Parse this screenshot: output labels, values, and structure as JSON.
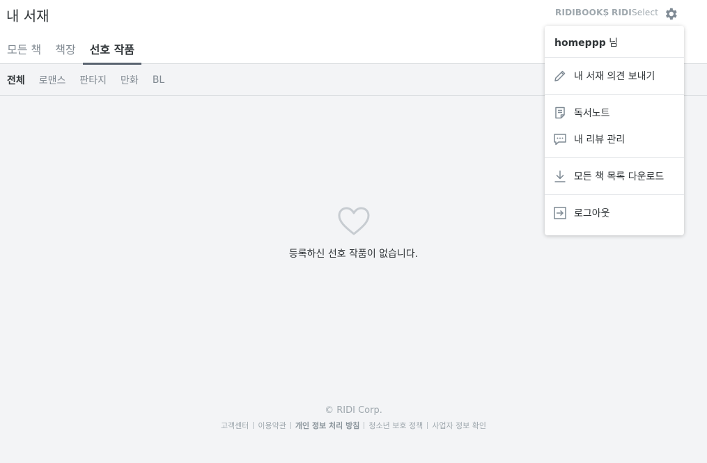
{
  "header": {
    "title": "내 서재",
    "brand_ridibooks": "RIDIBOOKS",
    "brand_ridi": "RIDI",
    "brand_select": "Select",
    "settings_icon": "gear-icon"
  },
  "main_tabs": [
    {
      "label": "모든 책",
      "active": false
    },
    {
      "label": "책장",
      "active": false
    },
    {
      "label": "선호 작품",
      "active": true
    }
  ],
  "sub_tabs": [
    {
      "label": "전체",
      "active": true
    },
    {
      "label": "로맨스",
      "active": false
    },
    {
      "label": "판타지",
      "active": false
    },
    {
      "label": "만화",
      "active": false
    },
    {
      "label": "BL",
      "active": false
    }
  ],
  "empty_state": {
    "icon": "heart-outline-icon",
    "message": "등록하신 선호 작품이 없습니다."
  },
  "menu": {
    "username": "homeppp",
    "honorific": " 님",
    "items": [
      {
        "label": "내 서재 의견 보내기",
        "icon": "pencil-icon"
      },
      {
        "label": "독서노트",
        "icon": "note-icon"
      },
      {
        "label": "내 리뷰 관리",
        "icon": "comment-icon"
      },
      {
        "label": "모든 책 목록 다운로드",
        "icon": "download-icon"
      },
      {
        "label": "로그아웃",
        "icon": "logout-icon"
      }
    ]
  },
  "footer": {
    "copyright": "© RIDI Corp.",
    "links": [
      "고객센터",
      "이용약관",
      "개인 정보 처리 방침",
      "청소년 보호 정책",
      "사업자 정보 확인"
    ]
  },
  "colors": {
    "background": "#f3f4f6",
    "text": "#303538",
    "muted": "#808991",
    "brand_gray": "#9ea7ad"
  }
}
